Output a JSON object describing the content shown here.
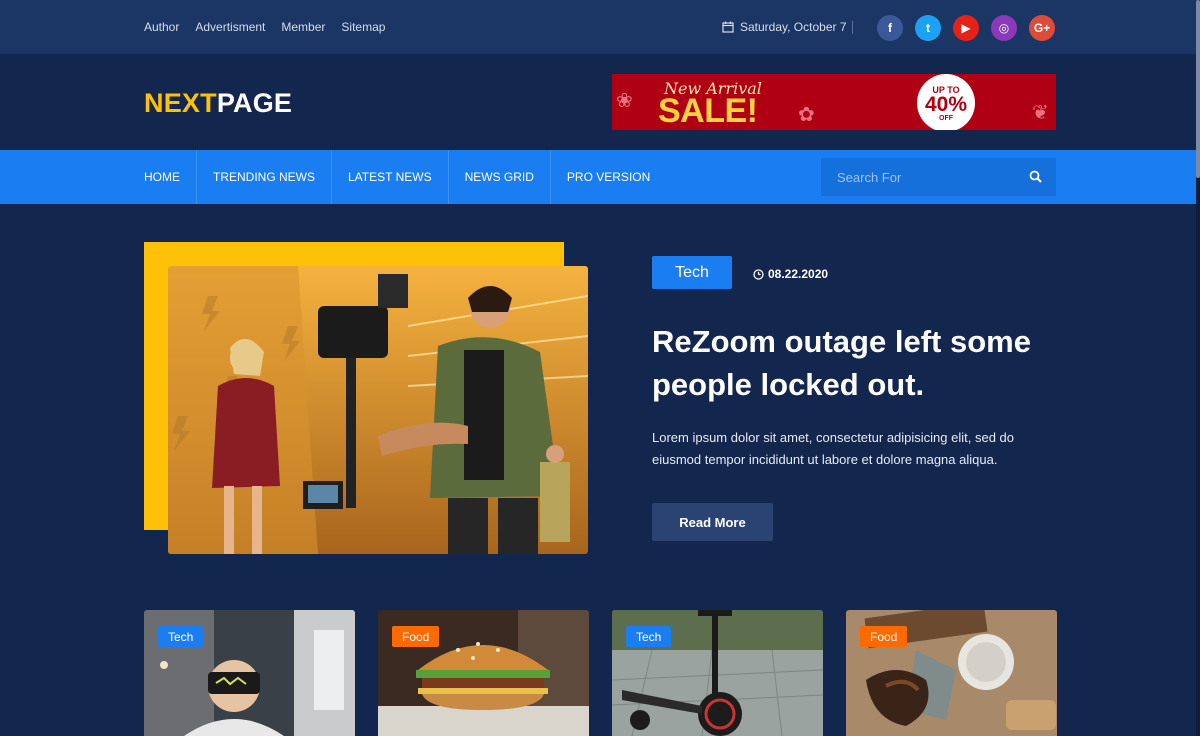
{
  "topbar": {
    "links": [
      "Author",
      "Advertisment",
      "Member",
      "Sitemap"
    ],
    "date": "Saturday, October 7",
    "social": [
      {
        "name": "facebook-icon",
        "glyph": "f",
        "color": "#3b5998"
      },
      {
        "name": "twitter-icon",
        "glyph": "t",
        "color": "#1da1f2"
      },
      {
        "name": "youtube-icon",
        "glyph": "▶",
        "color": "#e62117"
      },
      {
        "name": "instagram-icon",
        "glyph": "◎",
        "color": "#8a3ab9"
      },
      {
        "name": "google-plus-icon",
        "glyph": "G+",
        "color": "#dd4b39"
      }
    ]
  },
  "logo": {
    "part1": "NEXT",
    "part2": "PAGE"
  },
  "banner": {
    "line1": "New Arrival",
    "line2": "SALE!",
    "badge_top": "UP TO",
    "badge_pct": "40%",
    "badge_off": "OFF"
  },
  "nav": {
    "items": [
      "HOME",
      "TRENDING NEWS",
      "LATEST NEWS",
      "NEWS GRID",
      "PRO VERSION"
    ],
    "search_placeholder": "Search For"
  },
  "hero": {
    "tag": "Tech",
    "date": "08.22.2020",
    "title": "ReZoom outage left some people locked out.",
    "text": "Lorem ipsum dolor sit amet, consectetur adipisicing elit, sed do eiusmod tempor incididunt ut labore et dolore magna aliqua.",
    "button": "Read More"
  },
  "cards": [
    {
      "tag": "Tech",
      "tag_color": "#1a7ef2"
    },
    {
      "tag": "Food",
      "tag_color": "#ff6a00"
    },
    {
      "tag": "Tech",
      "tag_color": "#1a7ef2"
    },
    {
      "tag": "Food",
      "tag_color": "#ff6a00"
    }
  ],
  "colors": {
    "accent": "#ffc107",
    "primary": "#1a7ef2",
    "background": "#13264e"
  }
}
